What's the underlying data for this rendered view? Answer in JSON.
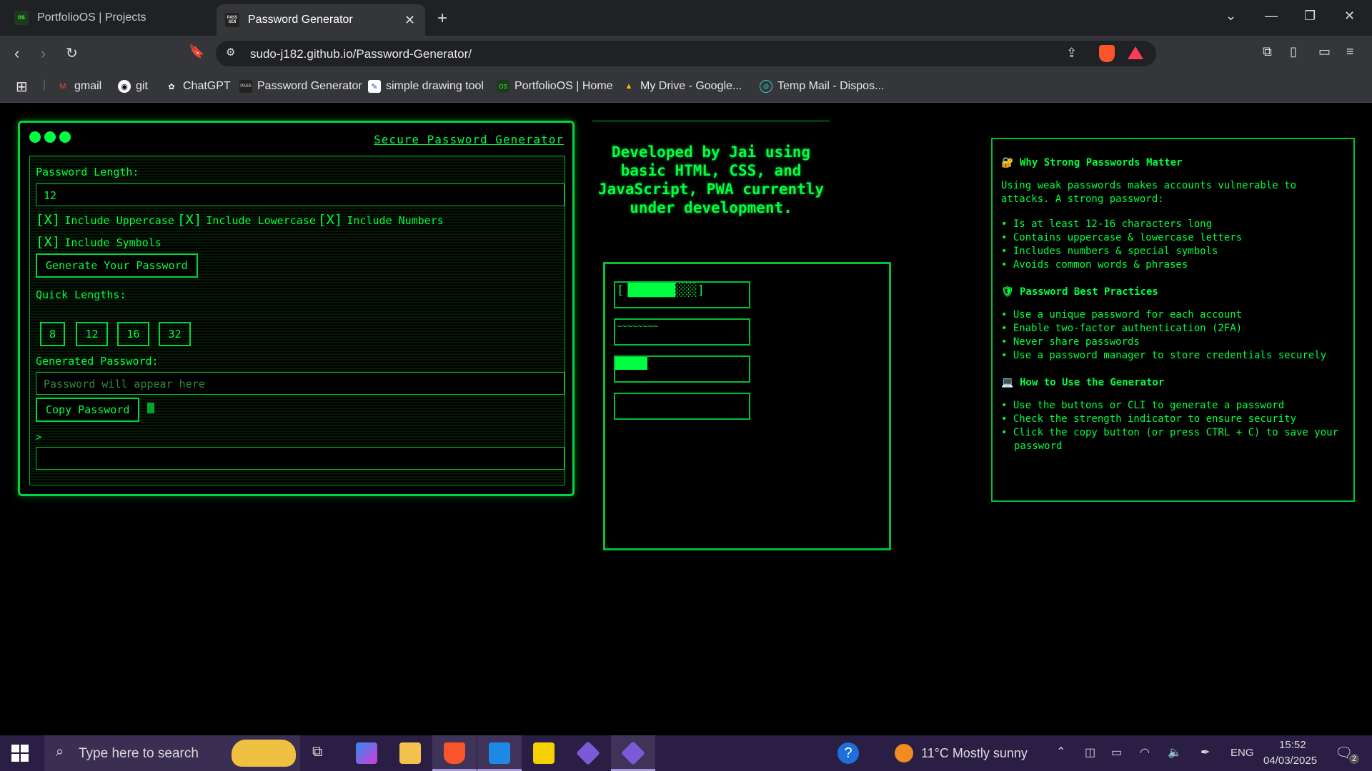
{
  "browser": {
    "tabs": [
      {
        "title": "PortfolioOS | Projects",
        "favicon": "OS",
        "active": false
      },
      {
        "title": "Password Generator",
        "favicon": "PASS GEN",
        "active": true
      }
    ],
    "url": "sudo-j182.github.io/Password-Generator/",
    "bookmarks": [
      {
        "label": "gmail",
        "icon": "gmail-icon"
      },
      {
        "label": "git",
        "icon": "github-icon"
      },
      {
        "label": "ChatGPT",
        "icon": "chatgpt-icon"
      },
      {
        "label": "Password Generator",
        "icon": "passgen-icon"
      },
      {
        "label": "simple drawing tool",
        "icon": "drawing-icon"
      },
      {
        "label": "PortfolioOS | Home",
        "icon": "portfolioos-icon"
      },
      {
        "label": "My Drive - Google...",
        "icon": "drive-icon"
      },
      {
        "label": "Temp Mail - Dispos...",
        "icon": "tempmail-icon"
      }
    ]
  },
  "generator": {
    "window_title": "Secure Password Generator",
    "length_label": "Password Length:",
    "length_value": "12",
    "options": [
      {
        "box": "[X]",
        "label": "Include Uppercase"
      },
      {
        "box": "[X]",
        "label": "Include Lowercase"
      },
      {
        "box": "[X]",
        "label": "Include Numbers"
      },
      {
        "box": "[X]",
        "label": "Include Symbols"
      }
    ],
    "generate_label": "Generate Your Password",
    "quick_label": "Quick Lengths:",
    "quick_lengths": [
      "8",
      "12",
      "16",
      "32"
    ],
    "generated_label": "Generated Password:",
    "password_placeholder": "Password will appear here",
    "copy_label": "Copy Password",
    "prompt": ">",
    "cli_value": ""
  },
  "developer_note": "Developed by Jai using basic HTML, CSS, and JavaScript, PWA currently under development.",
  "visualizer": {
    "strength_bar": "[▐██████░░░]",
    "wave": "~~~~~~~~",
    "fill_bar_fraction": 0.24
  },
  "info": {
    "sections": [
      {
        "icon": "lock-icon",
        "glyph": "🔐",
        "title": "Why Strong Passwords Matter",
        "intro": "Using weak passwords makes accounts vulnerable to attacks. A strong password:",
        "items": [
          "• Is at least 12-16 characters long",
          "• Contains uppercase & lowercase letters",
          "• Includes numbers & special symbols",
          "• Avoids common words & phrases"
        ]
      },
      {
        "icon": "shield-icon",
        "glyph": "🛡",
        "title": "Password Best Practices",
        "intro": "",
        "items": [
          "• Use a unique password for each account",
          "• Enable two-factor authentication (2FA)",
          "• Never share passwords",
          "• Use a password manager to store credentials securely"
        ]
      },
      {
        "icon": "laptop-icon",
        "glyph": "💻",
        "title": "How to Use the Generator",
        "intro": "",
        "items": [
          "• Use the buttons or CLI to generate a password",
          "• Check the strength indicator to ensure security",
          "• Click the copy button (or press CTRL + C) to save your password"
        ]
      }
    ]
  },
  "taskbar": {
    "search_placeholder": "Type here to search",
    "weather": "11°C  Mostly sunny",
    "language": "ENG",
    "time": "15:52",
    "date": "04/03/2025",
    "notification_count": "2"
  }
}
